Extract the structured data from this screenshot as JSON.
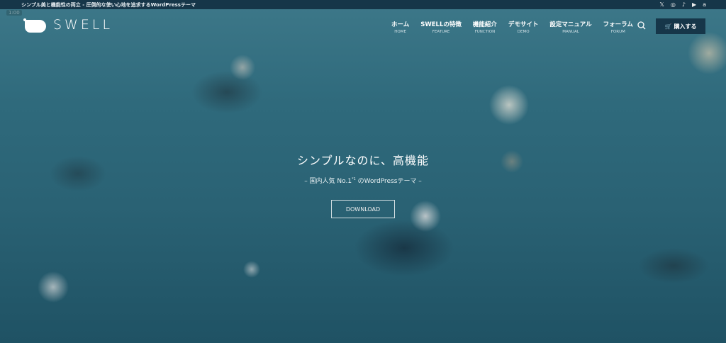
{
  "topbar": {
    "tagline": "シンプル美と機能性の両立 - 圧倒的な使い心地を追求するWordPressテーマ",
    "social": [
      {
        "icon": "x-icon",
        "glyph": "𝕏"
      },
      {
        "icon": "instagram-icon",
        "glyph": "◎"
      },
      {
        "icon": "tiktok-icon",
        "glyph": "♪"
      },
      {
        "icon": "youtube-icon",
        "glyph": "▶"
      },
      {
        "icon": "amazon-icon",
        "glyph": "a"
      }
    ]
  },
  "overlay": {
    "timer": "1:00"
  },
  "logo": {
    "text": "SWELL"
  },
  "nav": {
    "items": [
      {
        "jp": "ホーム",
        "en": "HOME"
      },
      {
        "jp": "SWELLの特徴",
        "en": "FEATURE"
      },
      {
        "jp": "機能紹介",
        "en": "FUNCTION"
      },
      {
        "jp": "デモサイト",
        "en": "DEMO"
      },
      {
        "jp": "設定マニュアル",
        "en": "MANUAL"
      },
      {
        "jp": "フォーラム",
        "en": "FORUM"
      }
    ],
    "buy_label": "購入する"
  },
  "hero": {
    "catch": "シンプルなのに、高機能",
    "sub_pre": "– 国内人気 No.1",
    "sub_sup": "*1",
    "sub_post": " のWordPressテーマ –",
    "button": "DOWNLOAD"
  },
  "colors": {
    "topbar": "#163649",
    "buy_button": "#163649"
  }
}
